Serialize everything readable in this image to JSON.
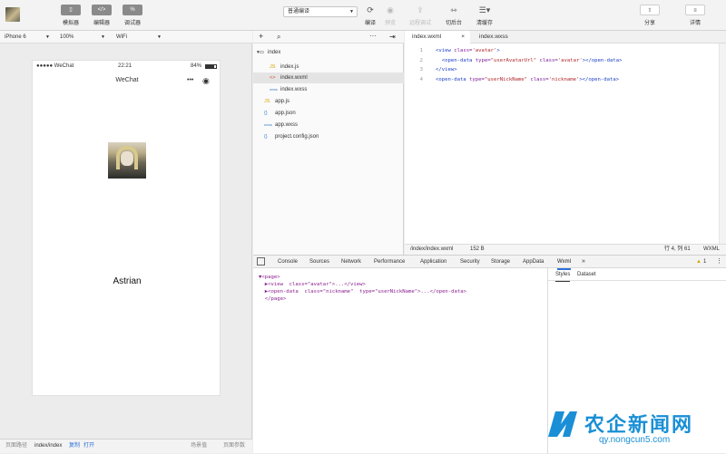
{
  "toolbar": {
    "simulator_label": "模拟器",
    "editor_label": "编辑器",
    "debugger_label": "调试器",
    "compile_mode": "普通编译",
    "compile_label": "编译",
    "preview_label": "预览",
    "remote_debug_label": "远程调试",
    "background_label": "切后台",
    "clear_cache_label": "清缓存",
    "share_label": "分享",
    "details_label": "详情"
  },
  "sim_bar": {
    "device": "iPhone 6",
    "zoom": "100%",
    "network": "WiFi"
  },
  "phone": {
    "carrier": "●●●●● WeChat",
    "time": "22:21",
    "battery": "84%",
    "nav_title": "WeChat",
    "nickname": "Astrian"
  },
  "status_bar": {
    "page_path_label": "页面路径",
    "page_path": "index/index",
    "copy_label": "复制",
    "open_label": "打开",
    "scene_label": "场景值",
    "params_label": "页面参数"
  },
  "files": {
    "folder": "index",
    "items": [
      {
        "icon": "JS",
        "name": "index.js"
      },
      {
        "icon": "<>",
        "name": "index.wxml"
      },
      {
        "icon": "wxss",
        "name": "index.wxss"
      }
    ],
    "root_items": [
      {
        "icon": "JS",
        "name": "app.js"
      },
      {
        "icon": "{}",
        "name": "app.json"
      },
      {
        "icon": "wxss",
        "name": "app.wxss"
      },
      {
        "icon": "{}",
        "name": "project.config.json"
      }
    ]
  },
  "editor": {
    "tabs": [
      "index.wxml",
      "index.wxss"
    ],
    "lines": [
      {
        "n": "1",
        "indent": "",
        "parts": [
          [
            "tg",
            "<view "
          ],
          [
            "at",
            "class="
          ],
          [
            "st",
            "'avatar'"
          ],
          [
            "tg",
            ">"
          ]
        ]
      },
      {
        "n": "2",
        "indent": "  ",
        "parts": [
          [
            "tg",
            "<open-data "
          ],
          [
            "at",
            "type="
          ],
          [
            "st",
            "\"userAvatarUrl\""
          ],
          [
            "at",
            " class="
          ],
          [
            "st",
            "'avatar'"
          ],
          [
            "tg",
            "></open-data>"
          ]
        ]
      },
      {
        "n": "3",
        "indent": "",
        "parts": [
          [
            "tg",
            "</view>"
          ]
        ]
      },
      {
        "n": "4",
        "indent": "",
        "parts": [
          [
            "tg",
            "<open-data "
          ],
          [
            "at",
            "type="
          ],
          [
            "st",
            "\"userNickName\""
          ],
          [
            "at",
            " class="
          ],
          [
            "st",
            "'nickname'"
          ],
          [
            "tg",
            "></open-data>"
          ]
        ]
      }
    ],
    "file_path": "/index/index.wxml",
    "file_size": "152 B",
    "cursor": "行 4, 列 61",
    "language": "WXML"
  },
  "devtools": {
    "tabs": [
      "Console",
      "Sources",
      "Network",
      "Performance",
      "Application",
      "Security",
      "Storage",
      "AppData",
      "Wxml"
    ],
    "active_tab": "Wxml",
    "warning_count": "1",
    "xml_lines": [
      "▼<page>",
      "  ▶<view  class=\"avatar\">...</view>",
      "  ▶<open-data  class=\"nickname\"  type=\"userNickName\">...</open-data>",
      "  </page>"
    ],
    "side_tabs": [
      "Styles",
      "Dataset"
    ]
  },
  "watermark": {
    "text": "农企新闻网",
    "url": "qy.nongcun5.com"
  }
}
